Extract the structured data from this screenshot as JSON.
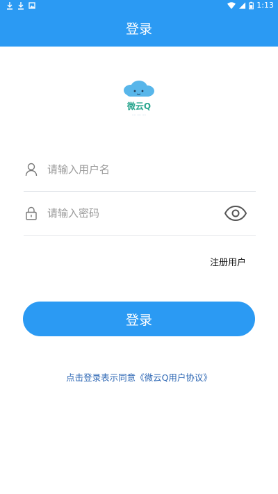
{
  "status_bar": {
    "time": "1:13"
  },
  "header": {
    "title": "登录"
  },
  "logo": {
    "text": "微云Q",
    "tagline": "···· ···· ····"
  },
  "form": {
    "username_placeholder": "请输入用户名",
    "password_placeholder": "请输入密码",
    "register_label": "注册用户",
    "login_label": "登录"
  },
  "agreement": {
    "prefix": "点击登录表示同意",
    "link": "《微云Q用户协议》"
  },
  "colors": {
    "primary": "#2b9af3",
    "link": "#2d67b4"
  }
}
